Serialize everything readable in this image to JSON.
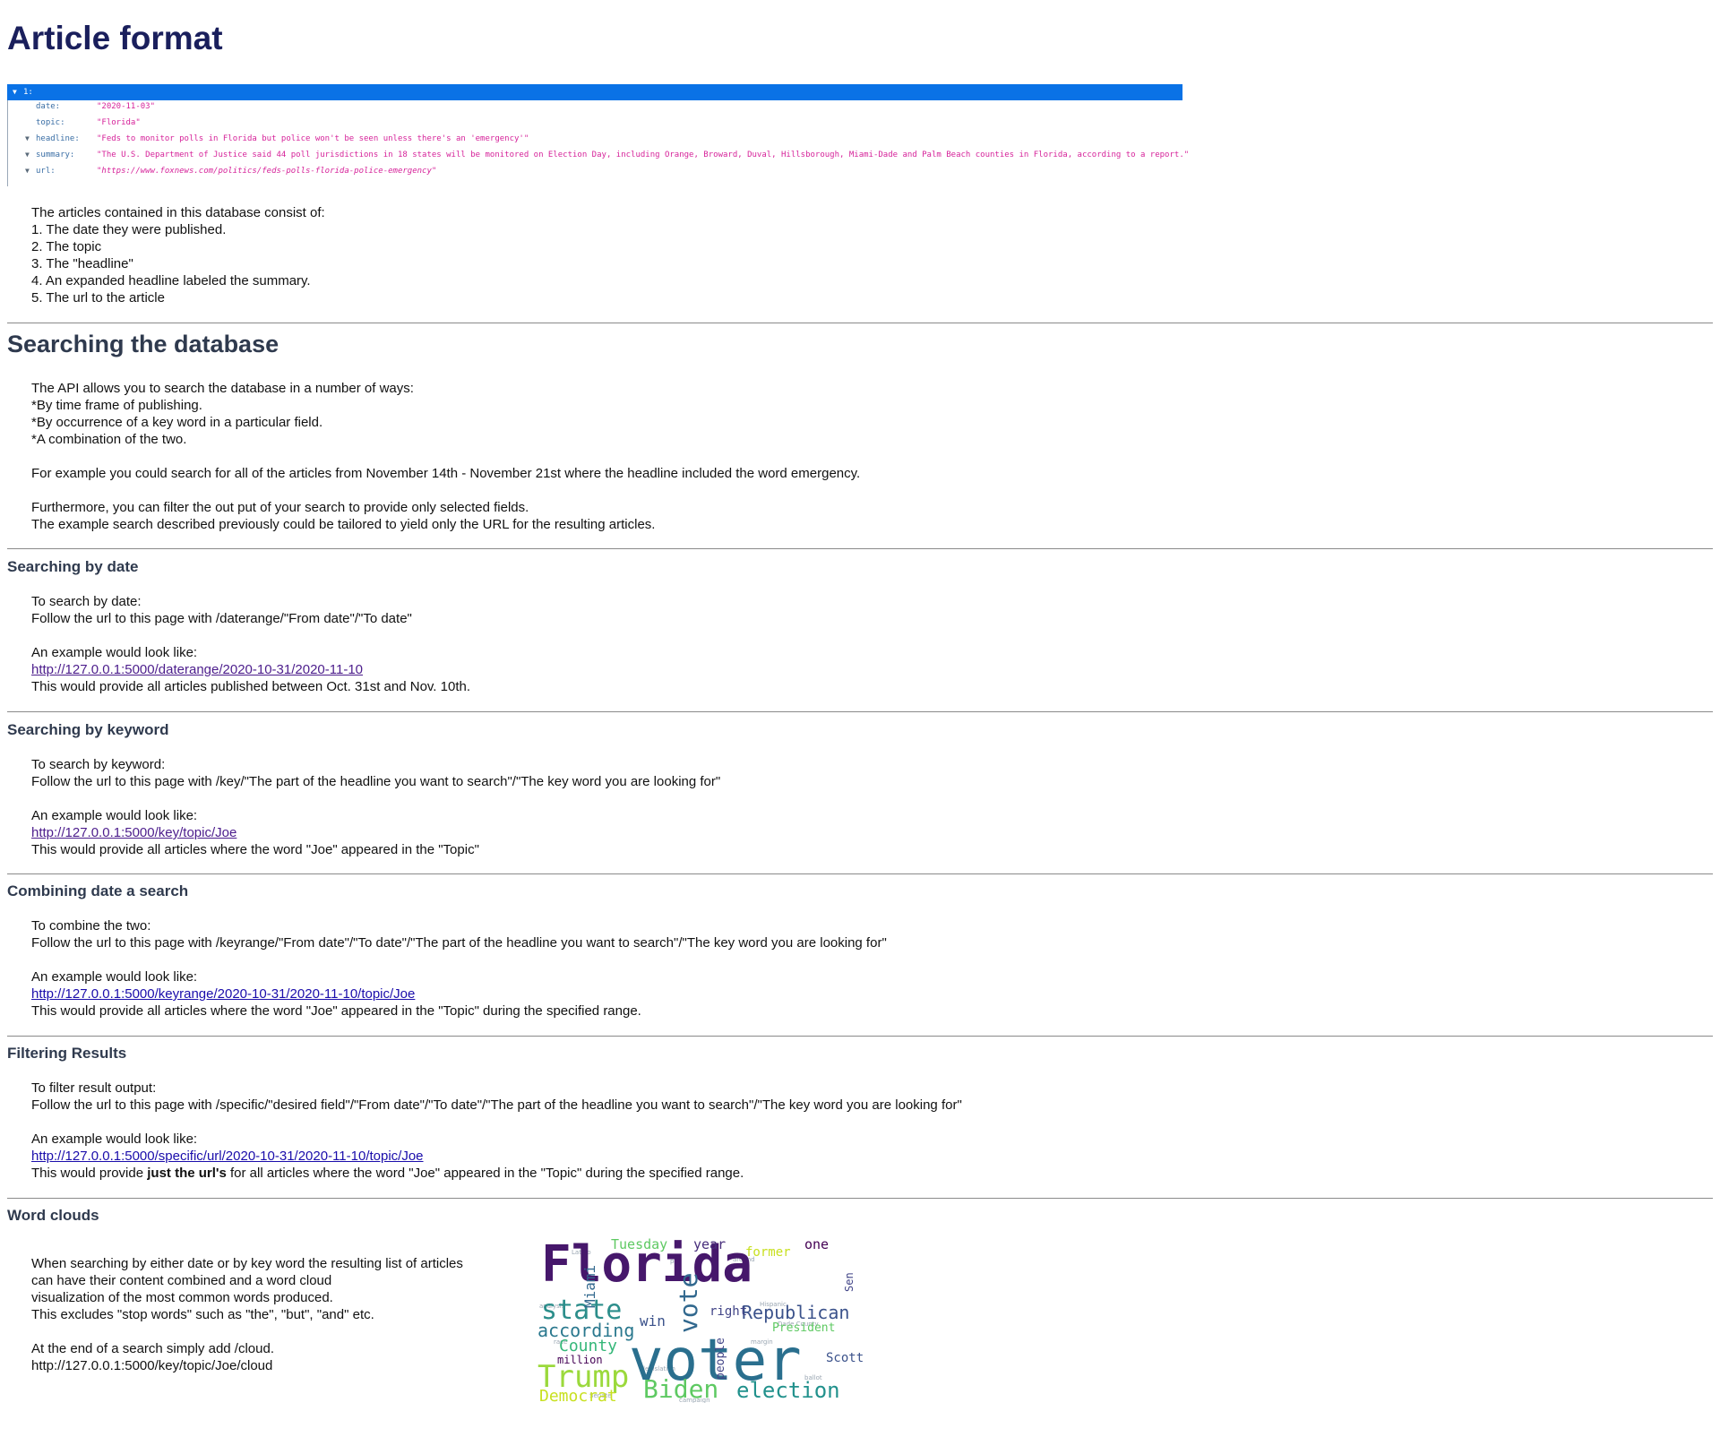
{
  "title": "Article format",
  "json_view": {
    "index_key": "1:",
    "rows": [
      {
        "key": "date:",
        "value": "\"2020-11-03\"",
        "expandable": false,
        "italic": false
      },
      {
        "key": "topic:",
        "value": "\"Florida\"",
        "expandable": false,
        "italic": false
      },
      {
        "key": "headline:",
        "value": "\"Feds to monitor polls in Florida but police won't be seen unless there's an 'emergency'\"",
        "expandable": true,
        "italic": false
      },
      {
        "key": "summary:",
        "value": "\"The U.S. Department of Justice said 44 poll jurisdictions in 18 states will be monitored on Election Day, including Orange, Broward, Duval, Hillsborough, Miami-Dade and Palm Beach counties in Florida, according to a report.\"",
        "expandable": true,
        "italic": false
      },
      {
        "key": "url:",
        "value": "\"https://www.foxnews.com/politics/feds-polls-florida-police-emergency\"",
        "expandable": true,
        "italic": true
      }
    ]
  },
  "format_desc": {
    "intro": "The articles contained in this database consist of:",
    "items": [
      "1. The date they were published.",
      "2. The topic",
      "3. The \"headline\"",
      "4. An expanded headline labeled the summary.",
      "5. The url to the article"
    ]
  },
  "searching": {
    "heading": "Searching the database",
    "lines": [
      "The API allows you to search the database in a number of ways:",
      "*By time frame of publishing.",
      "*By occurrence of a key word in a particular field.",
      "*A combination of the two."
    ],
    "example": "For example you could search for all of the articles from November 14th - November 21st where the headline included the word emergency.",
    "filter_lines": [
      "Furthermore, you can filter the out put of your search to provide only selected fields.",
      "The example search described previously could be tailored to yield only the URL for the resulting articles."
    ]
  },
  "by_date": {
    "heading": "Searching by date",
    "line1": "To search by date:",
    "line2": "Follow the url to this page with /daterange/\"From date\"/\"To date\"",
    "example_label": "An example would look like:",
    "link": "http://127.0.0.1:5000/daterange/2020-10-31/2020-11-10",
    "result": "This would provide all articles published between Oct. 31st and Nov. 10th."
  },
  "by_keyword": {
    "heading": "Searching by keyword",
    "line1": "To search by keyword:",
    "line2": "Follow the url to this page with /key/\"The part of the headline you want to search\"/\"The key word you are looking for\"",
    "example_label": "An example would look like:",
    "link": "http://127.0.0.1:5000/key/topic/Joe",
    "result": "This would provide all articles where the word \"Joe\" appeared in the \"Topic\""
  },
  "combining": {
    "heading": "Combining date a search",
    "line1": "To combine the two:",
    "line2": "Follow the url to this page with /keyrange/\"From date\"/\"To date\"/\"The part of the headline you want to search\"/\"The key word you are looking for\"",
    "example_label": "An example would look like:",
    "link": "http://127.0.0.1:5000/keyrange/2020-10-31/2020-11-10/topic/Joe",
    "result": "This would provide all articles where the word \"Joe\" appeared in the \"Topic\" during the specified range."
  },
  "filtering": {
    "heading": "Filtering Results",
    "line1": "To filter result output:",
    "line2": "Follow the url to this page with /specific/\"desired field\"/\"From date\"/\"To date\"/\"The part of the headline you want to search\"/\"The key word you are looking for\"",
    "example_label": "An example would look like:",
    "link": "http://127.0.0.1:5000/specific/url/2020-10-31/2020-11-10/topic/Joe",
    "result_pre": "This would provide ",
    "result_bold": "just the url's",
    "result_post": " for all articles where the word \"Joe\" appeared in the \"Topic\" during the specified range."
  },
  "word_clouds": {
    "heading": "Word clouds",
    "lines": [
      "When searching by either date or by key word the resulting list of articles",
      "can have their content combined and a word cloud",
      "visualization of the most common words produced.",
      "This excludes \"stop words\" such as \"the\", \"but\", \"and\" etc."
    ],
    "cloud_line1": "At the end of a search simply add /cloud.",
    "cloud_line2": "http://127.0.0.1:5000/key/topic/Joe/cloud",
    "words": [
      {
        "text": "Florida",
        "color": "#46176b"
      },
      {
        "text": "voter",
        "color": "#2a6f8e"
      },
      {
        "text": "state",
        "color": "#2c8e8b"
      },
      {
        "text": "Trump",
        "color": "#9bd93c"
      },
      {
        "text": "Biden",
        "color": "#5ec962"
      },
      {
        "text": "election",
        "color": "#21918c"
      },
      {
        "text": "Republican",
        "color": "#3b528b"
      },
      {
        "text": "vote",
        "color": "#31688e"
      },
      {
        "text": "according",
        "color": "#2a788e"
      },
      {
        "text": "County",
        "color": "#35b779"
      },
      {
        "text": "Democrat",
        "color": "#c8e020"
      },
      {
        "text": "Tuesday",
        "color": "#5ec962"
      },
      {
        "text": "year",
        "color": "#472d7b"
      },
      {
        "text": "former",
        "color": "#c8e020"
      },
      {
        "text": "one",
        "color": "#440154"
      },
      {
        "text": "Miami",
        "color": "#31688e"
      },
      {
        "text": "win",
        "color": "#3b528b"
      },
      {
        "text": "right",
        "color": "#414487"
      },
      {
        "text": "President",
        "color": "#5ec962"
      },
      {
        "text": "million",
        "color": "#440154"
      },
      {
        "text": "people",
        "color": "#414487"
      },
      {
        "text": "Scott",
        "color": "#3b528b"
      },
      {
        "text": "Sen",
        "color": "#414487"
      }
    ]
  },
  "colors": {
    "title": "#1a1f5c",
    "heading": "#2f3a4e",
    "json_bar": "#0a72e6",
    "json_key": "#3a6ea5",
    "json_value": "#d6239a",
    "link_visited": "#4c1d8c",
    "link": "#1a0dab"
  }
}
